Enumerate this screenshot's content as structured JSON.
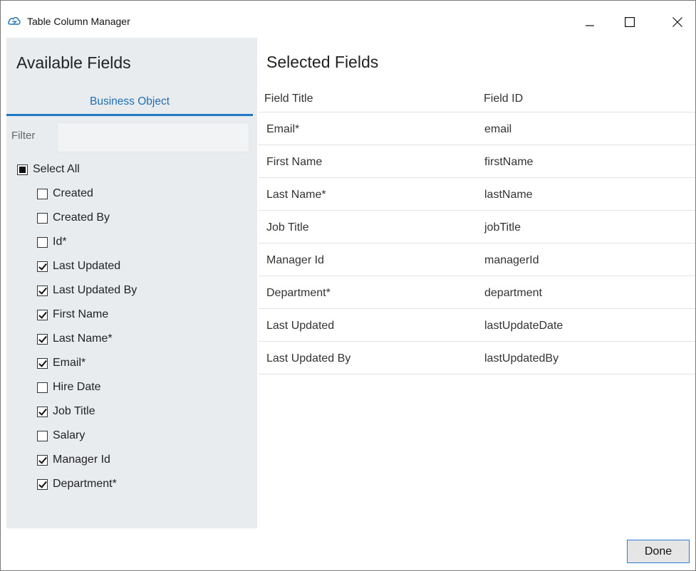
{
  "window": {
    "title": "Table Column Manager",
    "minimize_icon": "minimize-icon",
    "maximize_icon": "maximize-icon",
    "close_icon": "close-icon"
  },
  "available": {
    "title": "Available Fields",
    "tab_label": "Business Object",
    "filter_label": "Filter",
    "filter_value": "",
    "select_all": {
      "label": "Select All",
      "state": "partial"
    },
    "fields": [
      {
        "label": "Created",
        "checked": false
      },
      {
        "label": "Created By",
        "checked": false
      },
      {
        "label": "Id*",
        "checked": false
      },
      {
        "label": "Last Updated",
        "checked": true
      },
      {
        "label": "Last Updated By",
        "checked": true
      },
      {
        "label": "First Name",
        "checked": true
      },
      {
        "label": "Last Name*",
        "checked": true
      },
      {
        "label": "Email*",
        "checked": true
      },
      {
        "label": "Hire Date",
        "checked": false
      },
      {
        "label": "Job Title",
        "checked": true
      },
      {
        "label": "Salary",
        "checked": false
      },
      {
        "label": "Manager Id",
        "checked": true
      },
      {
        "label": "Department*",
        "checked": true
      }
    ]
  },
  "selected": {
    "title": "Selected Fields",
    "columns": [
      "Field Title",
      "Field ID"
    ],
    "rows": [
      [
        "Email*",
        "email"
      ],
      [
        "First Name",
        "firstName"
      ],
      [
        "Last Name*",
        "lastName"
      ],
      [
        "Job Title",
        "jobTitle"
      ],
      [
        "Manager Id",
        "managerId"
      ],
      [
        "Department*",
        "department"
      ],
      [
        "Last Updated",
        "lastUpdateDate"
      ],
      [
        "Last Updated By",
        "lastUpdatedBy"
      ]
    ]
  },
  "footer": {
    "done_label": "Done"
  },
  "colors": {
    "accent": "#1f78c4",
    "pane_bg": "#e9ecef",
    "tab_text": "#1f6fb2"
  }
}
